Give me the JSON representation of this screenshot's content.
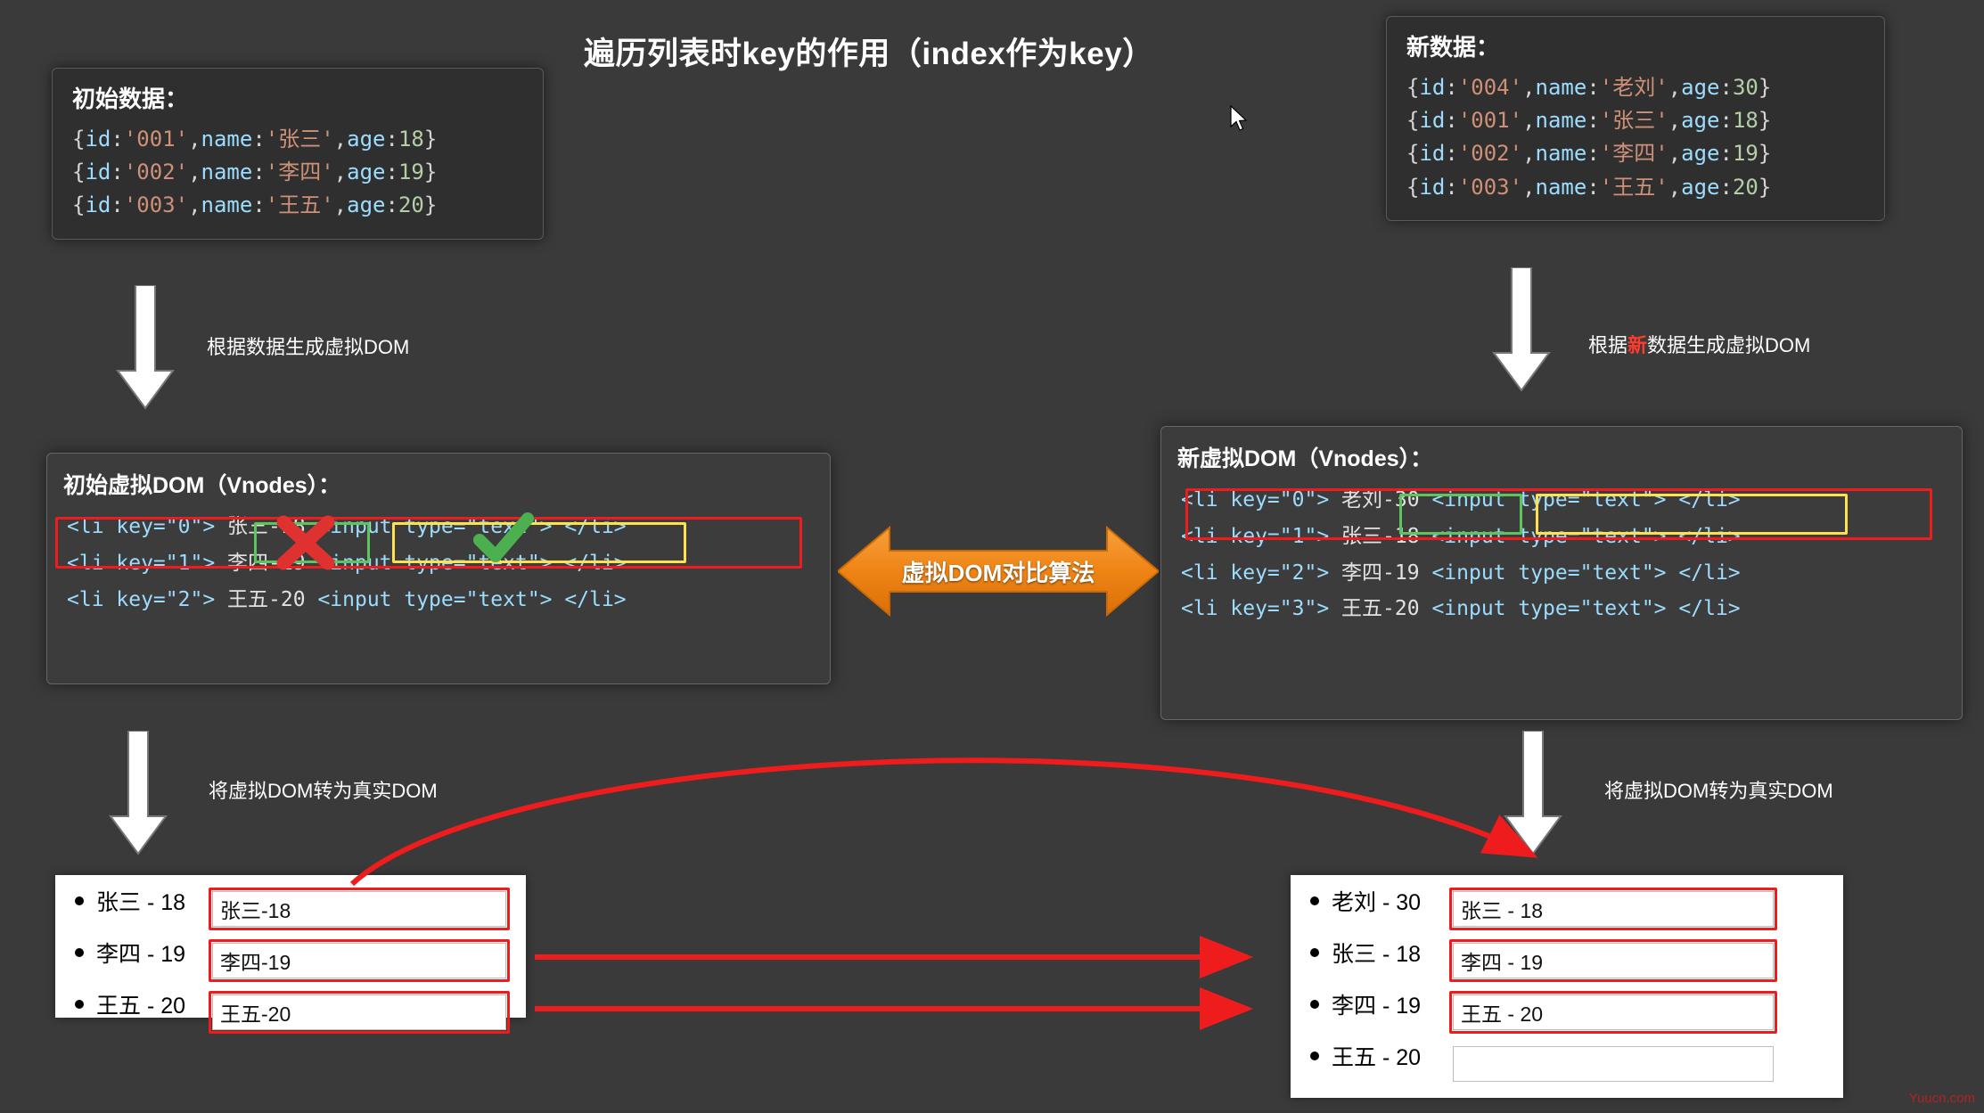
{
  "title": "遍历列表时key的作用（index作为key）",
  "watermark": "Yuucn.com",
  "initial_data": {
    "heading": "初始数据：",
    "lines": [
      "{id:'001',name:'张三',age:18}",
      "{id:'002',name:'李四',age:19}",
      "{id:'003',name:'王五',age:20}"
    ],
    "rows": [
      {
        "id": "'001'",
        "name": "'张三'",
        "age": "18"
      },
      {
        "id": "'002'",
        "name": "'李四'",
        "age": "19"
      },
      {
        "id": "'003'",
        "name": "'王五'",
        "age": "20"
      }
    ]
  },
  "new_data": {
    "heading": "新数据：",
    "rows": [
      {
        "id": "'004'",
        "name": "'老刘'",
        "age": "30"
      },
      {
        "id": "'001'",
        "name": "'张三'",
        "age": "18"
      },
      {
        "id": "'002'",
        "name": "'李四'",
        "age": "19"
      },
      {
        "id": "'003'",
        "name": "'王五'",
        "age": "20"
      }
    ]
  },
  "labels": {
    "gen_vdom_left": "根据数据生成虚拟DOM",
    "gen_vdom_right_prefix": "根据",
    "gen_vdom_right_hl": "新",
    "gen_vdom_right_suffix": "数据生成虚拟DOM",
    "to_real_dom_left": "将虚拟DOM转为真实DOM",
    "to_real_dom_right": "将虚拟DOM转为真实DOM",
    "diff_algorithm": "虚拟DOM对比算法"
  },
  "old_vdom": {
    "heading": "初始虚拟DOM（Vnodes）：",
    "lines": [
      {
        "open": "<li key=\"0\">",
        "text": "张三-18",
        "input": "<input type=\"text\">",
        "close": "</li>"
      },
      {
        "open": "<li key=\"1\">",
        "text": "李四-19",
        "input": "<input type=\"text\">",
        "close": "</li>"
      },
      {
        "open": "<li key=\"2\">",
        "text": "王五-20",
        "input": "<input type=\"text\">",
        "close": "</li>"
      }
    ]
  },
  "new_vdom": {
    "heading": "新虚拟DOM（Vnodes）：",
    "lines": [
      {
        "open": "<li key=\"0\">",
        "text": "老刘-30",
        "input": "<input type=\"text\">",
        "close": "</li>"
      },
      {
        "open": "<li key=\"1\">",
        "text": "张三-18",
        "input": "<input type=\"text\">",
        "close": "</li>"
      },
      {
        "open": "<li key=\"2\">",
        "text": "李四-19",
        "input": "<input type=\"text\">",
        "close": "</li>"
      },
      {
        "open": "<li key=\"3\">",
        "text": "王五-20",
        "input": "<input type=\"text\">",
        "close": "</li>"
      }
    ]
  },
  "old_dom": {
    "rows": [
      {
        "label": "张三 - 18",
        "input": "张三-18"
      },
      {
        "label": "李四 - 19",
        "input": "李四-19"
      },
      {
        "label": "王五 - 20",
        "input": "王五-20"
      }
    ]
  },
  "new_dom": {
    "rows": [
      {
        "label": "老刘 - 30",
        "input": "张三 - 18"
      },
      {
        "label": "张三 - 18",
        "input": "李四 - 19"
      },
      {
        "label": "李四 - 19",
        "input": "王五 - 20"
      },
      {
        "label": "王五 - 20",
        "input": ""
      }
    ]
  },
  "colors": {
    "background": "#3a3a3a",
    "panel": "#2f2f2f",
    "red": "#ee1c1c",
    "green": "#5ec45e",
    "yellow": "#ffe14d",
    "orange": "#ef8415",
    "accent_string": "#ce9178",
    "accent_key": "#9cdcfe",
    "accent_number": "#b5cea8"
  }
}
